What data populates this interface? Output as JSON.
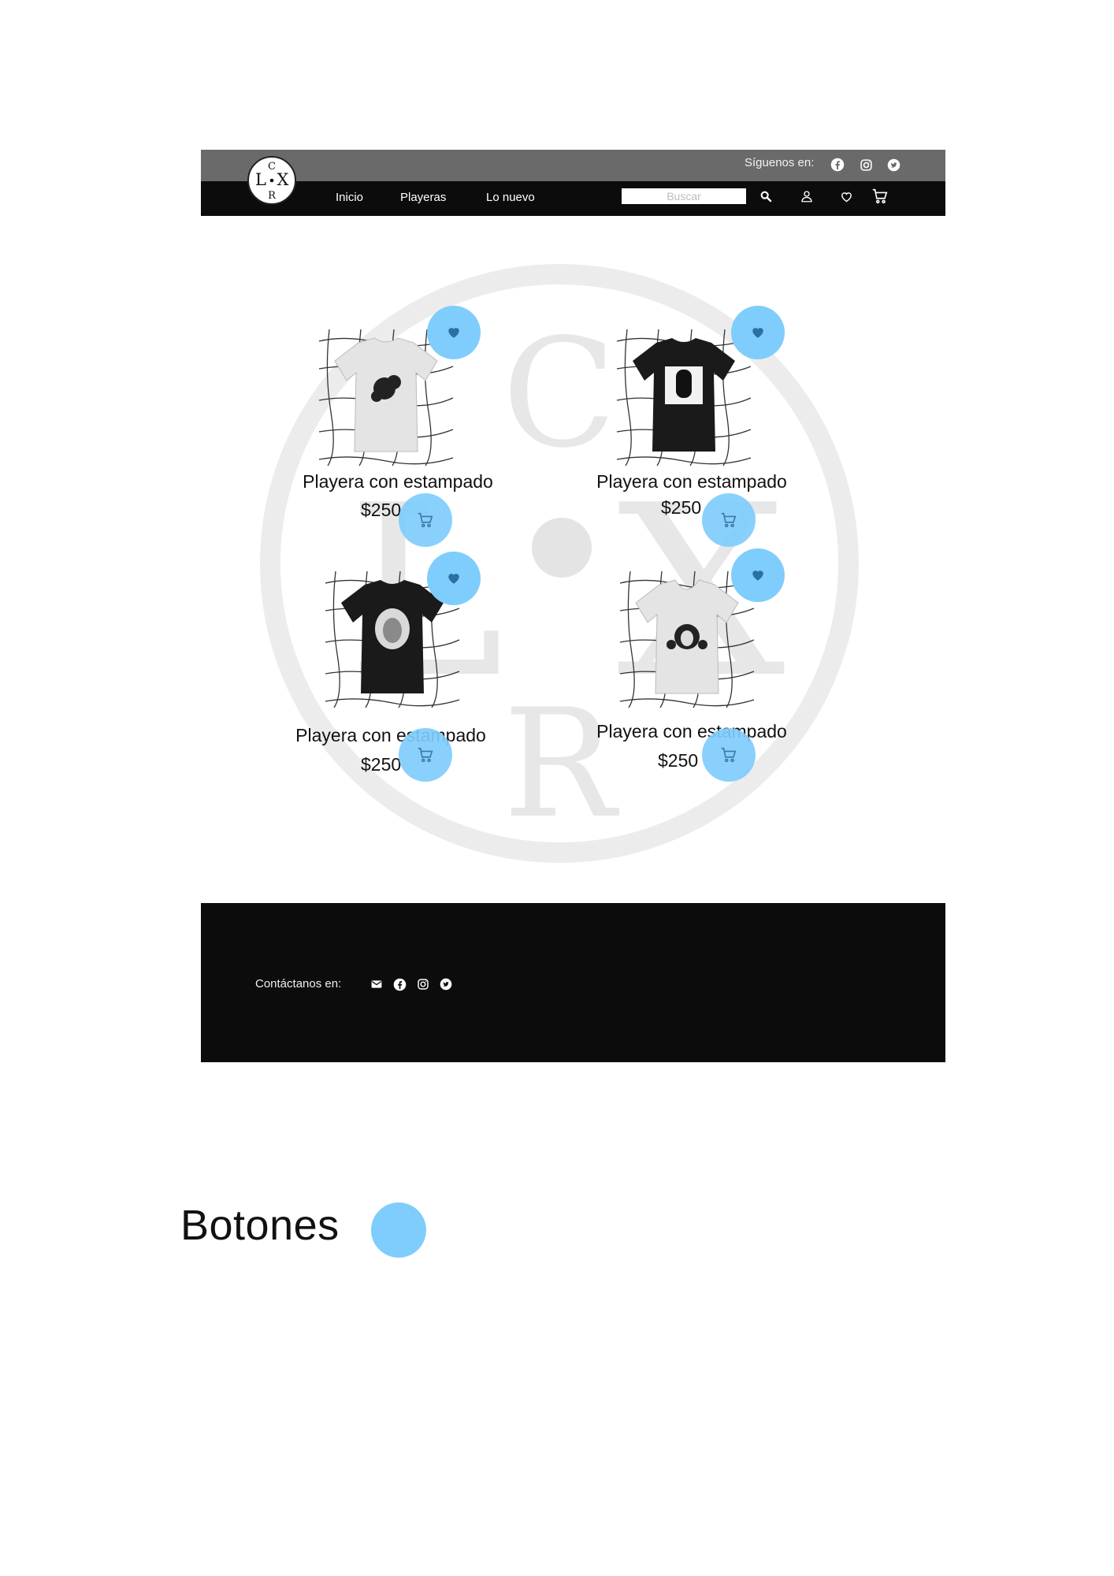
{
  "header": {
    "follow_label": "Síguenos en:",
    "social_icons": [
      "facebook-icon",
      "instagram-icon",
      "twitter-icon"
    ],
    "logo_letters": [
      "C",
      "L",
      "X",
      "R"
    ],
    "nav": [
      "Inicio",
      "Playeras",
      "Lo nuevo"
    ],
    "search": {
      "placeholder": "Buscar",
      "value": ""
    },
    "icons": [
      "search-icon",
      "user-icon",
      "heart-icon",
      "cart-icon"
    ]
  },
  "products": [
    {
      "title": "Playera con estampado",
      "price": "$250",
      "shirt_color": "#e4e4e4"
    },
    {
      "title": "Playera con estampado",
      "price": "$250",
      "shirt_color": "#1a1a1a"
    },
    {
      "title": "Playera con estampado",
      "price": "$250",
      "shirt_color": "#1a1a1a"
    },
    {
      "title": "Playera con estampado",
      "price": "$250",
      "shirt_color": "#e4e4e4"
    }
  ],
  "footer": {
    "contact_label": "Contáctanos en:",
    "icons": [
      "mail-icon",
      "facebook-icon",
      "instagram-icon",
      "twitter-icon"
    ]
  },
  "buttons_section": {
    "title": "Botones"
  },
  "colors": {
    "topbar": "#6a6a6a",
    "navbar": "#0c0c0c",
    "accent_button": "#7fcdfd",
    "icon_blue": "#2b6fa3",
    "footer": "#0c0c0c"
  }
}
